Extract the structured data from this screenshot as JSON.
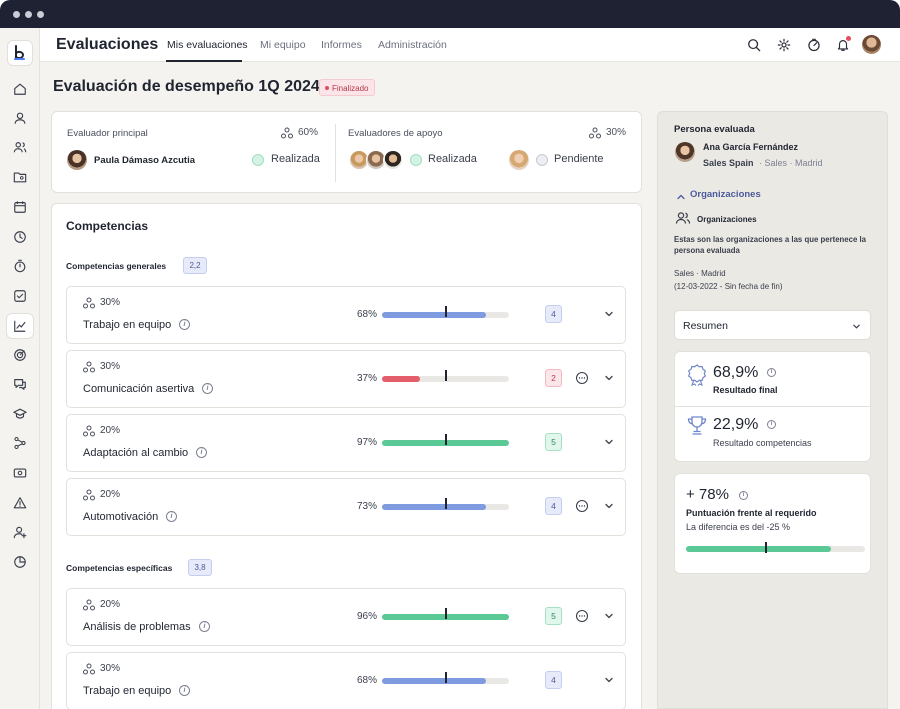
{
  "header": {
    "title": "Evaluaciones",
    "tabs": [
      {
        "label": "Mis evaluaciones",
        "active": true
      },
      {
        "label": "Mi equipo",
        "active": false
      },
      {
        "label": "Informes",
        "active": false
      },
      {
        "label": "Administración",
        "active": false
      }
    ],
    "icons": [
      "search-icon",
      "gear-icon",
      "speedometer-icon",
      "bell-icon",
      "user-avatar"
    ]
  },
  "sidebar": {
    "logo": "b",
    "icons": [
      "home-icon",
      "user-icon",
      "users-icon",
      "folder-user-icon",
      "calendar-icon",
      "clock-icon",
      "stopwatch-icon",
      "check-square-icon",
      "chart-line-icon",
      "target-icon",
      "chat-icon",
      "graduation-cap-icon",
      "flow-icon",
      "money-icon",
      "alert-icon",
      "user-plus-icon",
      "pie-chart-icon"
    ],
    "active_index": 8
  },
  "page": {
    "title": "Evaluación de desempeño 1Q 2024",
    "status": "Finalizado"
  },
  "evaluators": {
    "main": {
      "label": "Evaluador principal",
      "weight": "60%",
      "name": "Paula Dámaso Azcutia",
      "status": "Realizada"
    },
    "support": {
      "label": "Evaluadores de apoyo",
      "weight": "30%",
      "done_status": "Realizada",
      "pending_status": "Pendiente"
    }
  },
  "competencies": {
    "title": "Competencias",
    "groups": [
      {
        "title": "Competencias generales",
        "score": "2,2",
        "items": [
          {
            "weight": "30%",
            "name": "Trabajo en equipo",
            "pct": "68%",
            "value": 0.82,
            "color": "#7e9be0",
            "score": "4",
            "chip_style": "blue",
            "comment": false
          },
          {
            "weight": "30%",
            "name": "Comunicación asertiva",
            "pct": "37%",
            "value": 0.3,
            "color": "#e35d6a",
            "score": "2",
            "chip_style": "red",
            "comment": true
          },
          {
            "weight": "20%",
            "name": "Adaptación al cambio",
            "pct": "97%",
            "value": 1.0,
            "color": "#5bc995",
            "score": "5",
            "chip_style": "green",
            "comment": false
          },
          {
            "weight": "20%",
            "name": "Automotivación",
            "pct": "73%",
            "value": 0.82,
            "color": "#7e9be0",
            "score": "4",
            "chip_style": "blue",
            "comment": true
          }
        ]
      },
      {
        "title": "Competencias específicas",
        "score": "3,8",
        "items": [
          {
            "weight": "20%",
            "name": "Análisis de problemas",
            "pct": "96%",
            "value": 1.0,
            "color": "#5bc995",
            "score": "5",
            "chip_style": "green",
            "comment": true
          },
          {
            "weight": "30%",
            "name": "Trabajo en equipo",
            "pct": "68%",
            "value": 0.82,
            "color": "#7e9be0",
            "score": "4",
            "chip_style": "blue",
            "comment": false
          }
        ]
      }
    ]
  },
  "right_panel": {
    "title": "Persona evaluada",
    "person_name": "Ana García Fernández",
    "person_team": "Sales Spain",
    "person_sub": "· Sales · Madrid",
    "org_toggle": "Organizaciones",
    "org_title": "Organizaciones",
    "org_desc": "Estas son las organizaciones a las que pertenece la persona evaluada",
    "org_line1": "Sales · Madrid",
    "org_line2": "(12-03-2022 - Sin fecha de fin)",
    "select_value": "Resumen",
    "final_value": "68,9%",
    "final_label": "Resultado final",
    "comp_value": "22,9%",
    "comp_label": "Resultado competencias",
    "score_value": "+ 78%",
    "score_label": "Puntuación frente al requerido",
    "score_desc": "La diferencia es del -25 %",
    "score_fill": 0.81
  }
}
